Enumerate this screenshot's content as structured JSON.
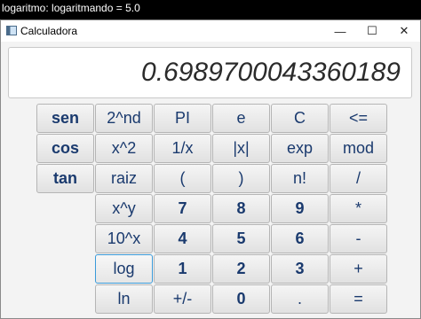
{
  "console": {
    "text": "logaritmo: logaritmando = 5.0"
  },
  "window": {
    "title": "Calculadora",
    "controls": {
      "minimize": "—",
      "maximize": "☐",
      "close": "✕"
    }
  },
  "display": {
    "value": "0.6989700043360189"
  },
  "keys": {
    "sen": "sen",
    "cos": "cos",
    "tan": "tan",
    "second": "2^nd",
    "pi": "PI",
    "e": "e",
    "clear": "C",
    "backspace": "<=",
    "square": "x^2",
    "reciprocal": "1/x",
    "abs": "|x|",
    "exp": "exp",
    "mod": "mod",
    "root": "raiz",
    "open_paren": "(",
    "close_paren": ")",
    "factorial": "n!",
    "divide": "/",
    "power": "x^y",
    "seven": "7",
    "eight": "8",
    "nine": "9",
    "multiply": "*",
    "ten_power": "10^x",
    "four": "4",
    "five": "5",
    "six": "6",
    "minus": "-",
    "log": "log",
    "one": "1",
    "two": "2",
    "three": "3",
    "plus": "+",
    "ln": "ln",
    "negate": "+/-",
    "zero": "0",
    "dot": ".",
    "equals": "="
  }
}
